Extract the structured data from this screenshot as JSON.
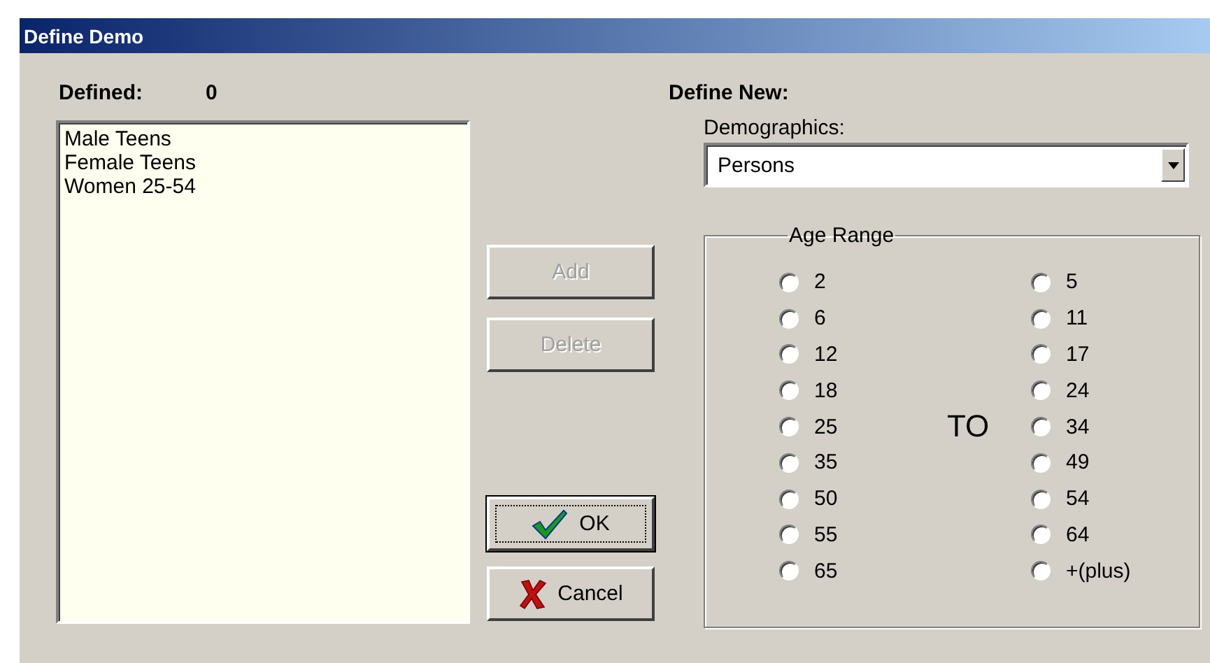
{
  "window": {
    "title": "Define Demo"
  },
  "defined": {
    "label": "Defined:",
    "count": "0",
    "items": [
      "Male Teens",
      "Female Teens",
      "Women 25-54"
    ]
  },
  "buttons": [
    {
      "kind": "add",
      "label": "Add",
      "disabled": true,
      "default": false
    },
    {
      "kind": "delete",
      "label": "Delete",
      "disabled": true,
      "default": false
    },
    {
      "kind": "ok",
      "label": "OK",
      "disabled": false,
      "default": true
    },
    {
      "kind": "cancel",
      "label": "Cancel",
      "disabled": false,
      "default": false
    }
  ],
  "define_new": {
    "label": "Define New:",
    "demographics_label": "Demographics:",
    "demographics_value": "Persons"
  },
  "age_range": {
    "title": "Age Range",
    "to_label": "TO",
    "from": [
      {
        "label": "2",
        "selected": false
      },
      {
        "label": "6",
        "selected": false
      },
      {
        "label": "12",
        "selected": false
      },
      {
        "label": "18",
        "selected": false
      },
      {
        "label": "25",
        "selected": false
      },
      {
        "label": "35",
        "selected": false
      },
      {
        "label": "50",
        "selected": false
      },
      {
        "label": "55",
        "selected": false
      },
      {
        "label": "65",
        "selected": false
      }
    ],
    "to": [
      {
        "label": "5",
        "selected": false
      },
      {
        "label": "11",
        "selected": false
      },
      {
        "label": "17",
        "selected": false
      },
      {
        "label": "24",
        "selected": false
      },
      {
        "label": "34",
        "selected": false
      },
      {
        "label": "49",
        "selected": false
      },
      {
        "label": "54",
        "selected": false
      },
      {
        "label": "64",
        "selected": false
      },
      {
        "label": "+(plus)",
        "selected": false
      }
    ]
  }
}
